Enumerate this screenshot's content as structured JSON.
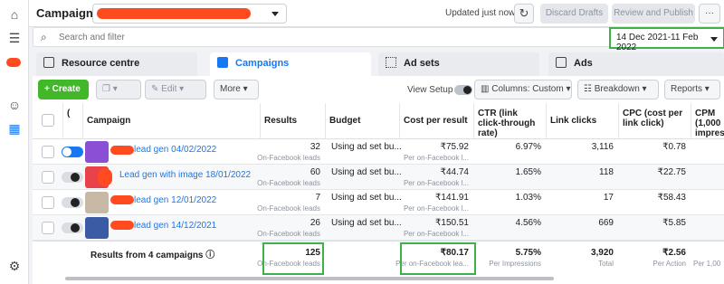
{
  "topbar": {
    "title": "Campaigns",
    "updated_text": "Updated just now",
    "discard_label": "Discard Drafts",
    "review_label": "Review and Publish",
    "more_label": "···"
  },
  "search": {
    "placeholder": "Search and filter"
  },
  "date_range": "14 Dec 2021-11 Feb 2022",
  "tabs": [
    {
      "label": "Resource centre",
      "icon": "resource-icon"
    },
    {
      "label": "Campaigns",
      "icon": "campaigns-icon",
      "active": true
    },
    {
      "label": "Ad sets",
      "icon": "adsets-icon"
    },
    {
      "label": "Ads",
      "icon": "ads-icon"
    }
  ],
  "toolbar": {
    "create_label": "Create",
    "edit_label": "Edit",
    "more_label": "More",
    "view_setup_label": "View Setup",
    "columns_label": "Columns: Custom",
    "breakdown_label": "Breakdown",
    "reports_label": "Reports"
  },
  "table": {
    "headers": [
      "Campaign",
      "Results",
      "Budget",
      "Cost per result",
      "CTR (link click-through rate)",
      "Link clicks",
      "CPC (cost per link click)",
      "CPM (1,000 impres"
    ],
    "rows": [
      {
        "name": "lead gen 04/02/2022",
        "results": "32",
        "results_sub": "On-Facebook leads",
        "budget": "Using ad set bu...",
        "cost": "₹75.92",
        "cost_sub": "Per on-Facebook l...",
        "ctr": "6.97%",
        "clicks": "3,116",
        "cpc": "₹0.78",
        "active": true
      },
      {
        "name": "Lead gen with image 18/01/2022",
        "results": "60",
        "results_sub": "On-Facebook leads",
        "budget": "Using ad set bu...",
        "cost": "₹44.74",
        "cost_sub": "Per on-Facebook l...",
        "ctr": "1.65%",
        "clicks": "118",
        "cpc": "₹22.75",
        "active": false
      },
      {
        "name": "lead gen 12/01/2022",
        "results": "7",
        "results_sub": "On-Facebook leads",
        "budget": "Using ad set bu...",
        "cost": "₹141.91",
        "cost_sub": "Per on-Facebook l...",
        "ctr": "1.03%",
        "clicks": "17",
        "cpc": "₹58.43",
        "active": false
      },
      {
        "name": "lead gen 14/12/2021",
        "results": "26",
        "results_sub": "On-Facebook leads",
        "budget": "Using ad set bu...",
        "cost": "₹150.51",
        "cost_sub": "Per on-Facebook l...",
        "ctr": "4.56%",
        "clicks": "669",
        "cpc": "₹5.85",
        "active": false
      }
    ],
    "footer": {
      "label": "Results from 4 campaigns",
      "results": "125",
      "results_sub": "On-Facebook leads",
      "cost": "₹80.17",
      "cost_sub": "Per on-Facebook lea...",
      "ctr": "5.75%",
      "ctr_sub": "Per Impressions",
      "clicks": "3,920",
      "clicks_sub": "Total",
      "cpc": "₹2.56",
      "cpc_sub": "Per Action",
      "cpm_sub": "Per 1,00"
    }
  },
  "colors": {
    "accent": "#1877f2",
    "create_green": "#42b72a",
    "highlight_green": "#3cb14a",
    "redaction": "#ff4b1f"
  }
}
